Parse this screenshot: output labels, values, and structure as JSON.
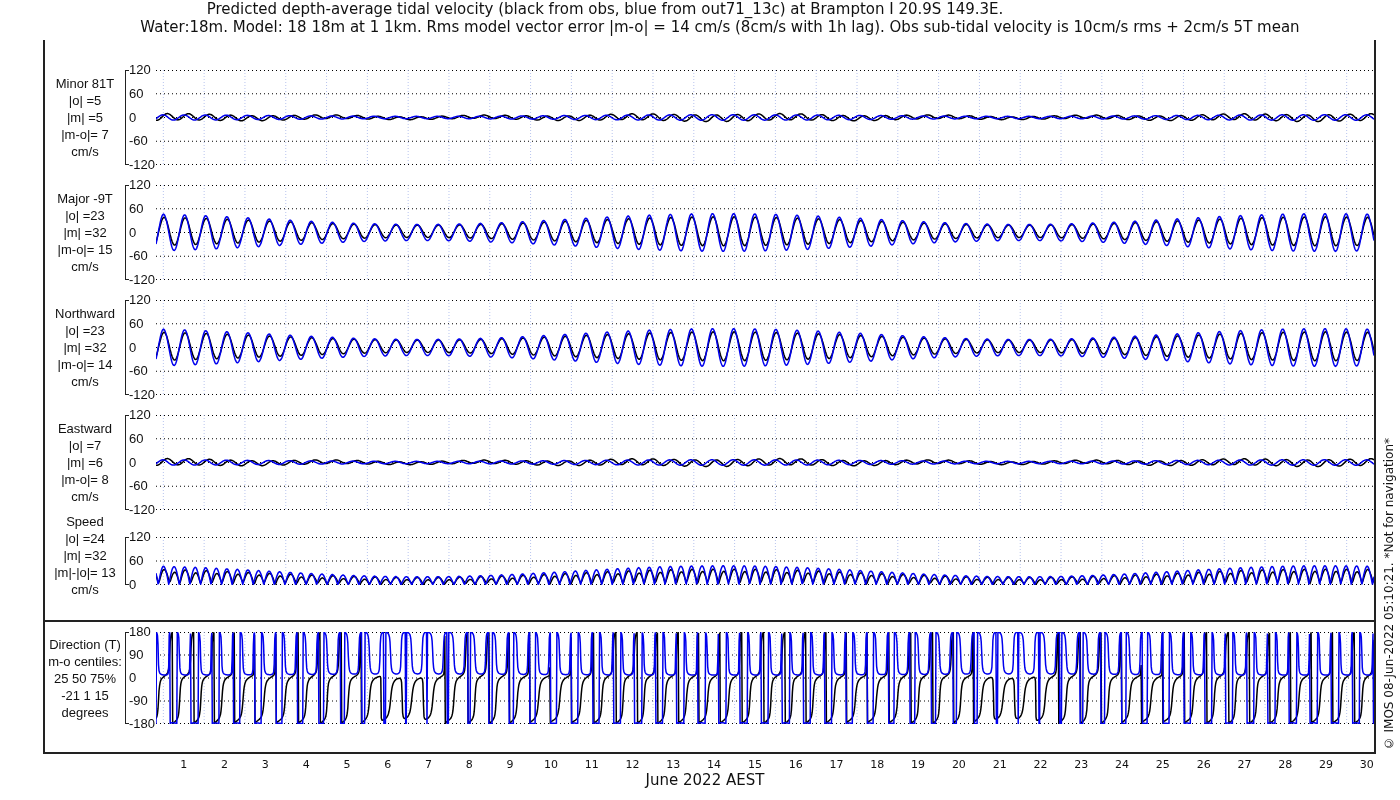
{
  "title": [
    "Predicted depth-average tidal velocity (black from obs, blue from out71_13c) at Brampton I 20.9S 149.3E.",
    "Water:18m. Model: 18 18m at 1 1km. Rms model vector error |m-o| = 14 cm/s (8cm/s with 1h lag). Obs sub-tidal velocity is 10cm/s rms + 2cm/s 5T mean"
  ],
  "panels": [
    {
      "kind": "minor",
      "label_lines": [
        "Minor 81T",
        "|o| =5",
        "|m| =5",
        "|m-o|= 7",
        "cm/s"
      ],
      "yticks": [
        "120",
        "60",
        "0",
        "-60",
        "-120"
      ]
    },
    {
      "kind": "major",
      "label_lines": [
        "Major -9T",
        "|o| =23",
        "|m| =32",
        "|m-o|= 15",
        "cm/s"
      ],
      "yticks": [
        "120",
        "60",
        "0",
        "-60",
        "-120"
      ]
    },
    {
      "kind": "major",
      "label_lines": [
        "Northward",
        "|o| =23",
        "|m| =32",
        "|m-o|= 14",
        "cm/s"
      ],
      "yticks": [
        "120",
        "60",
        "0",
        "-60",
        "-120"
      ]
    },
    {
      "kind": "minor",
      "label_lines": [
        "Eastward",
        "|o| =7",
        "|m| =6",
        "|m-o|= 8",
        "cm/s"
      ],
      "yticks": [
        "120",
        "60",
        "0",
        "-60",
        "-120"
      ]
    },
    {
      "kind": "speed",
      "label_lines": [
        "Speed",
        "|o| =24",
        "|m| =32",
        "|m|-|o|= 13",
        "cm/s"
      ],
      "yticks": [
        "120",
        "60",
        "0"
      ]
    },
    {
      "kind": "direction",
      "label_lines": [
        "Direction (T)",
        "m-o centiles:",
        "25  50  75%",
        "-21   1  15",
        "degrees"
      ],
      "yticks": [
        "180",
        "90",
        "0",
        "-90",
        "-180"
      ]
    }
  ],
  "days": [
    "1",
    "2",
    "3",
    "4",
    "5",
    "6",
    "7",
    "8",
    "9",
    "10",
    "11",
    "12",
    "13",
    "14",
    "15",
    "16",
    "17",
    "18",
    "19",
    "20",
    "21",
    "22",
    "23",
    "24",
    "25",
    "26",
    "27",
    "28",
    "29",
    "30"
  ],
  "xlabel": "June 2022 AEST",
  "note": "© IMOS 08-Jun-2022 05:10:21. *Not for navigation*"
}
